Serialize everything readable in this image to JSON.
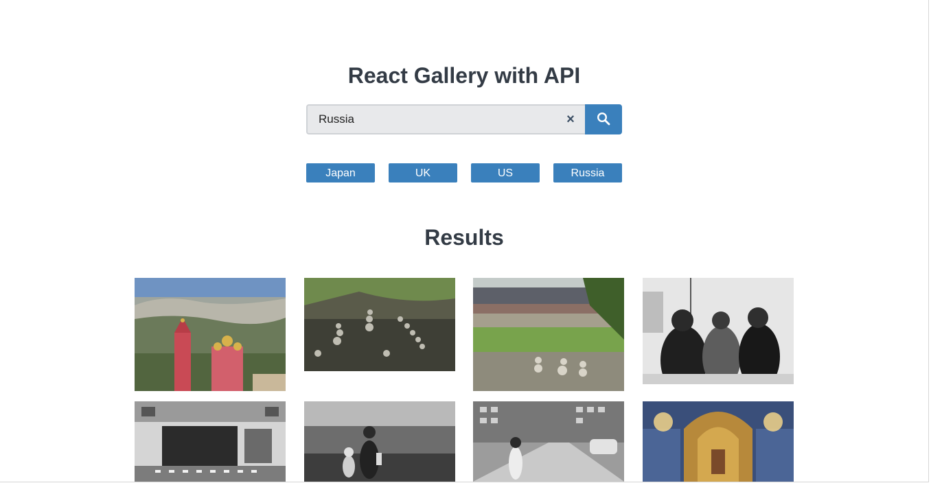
{
  "app": {
    "title": "React Gallery with API"
  },
  "search": {
    "value": "Russia",
    "clear_symbol": "×",
    "button_icon": "search-icon"
  },
  "tags": [
    {
      "label": "Japan"
    },
    {
      "label": "UK"
    },
    {
      "label": "US"
    },
    {
      "label": "Russia"
    }
  ],
  "results": {
    "heading": "Results",
    "photos": [
      {
        "subject": "church with red towers in front of hills"
      },
      {
        "subject": "stacked stone cairns on a hillside"
      },
      {
        "subject": "river under a bridge with stone stacks"
      },
      {
        "subject": "black and white people in winter jackets"
      },
      {
        "subject": "black and white building facade with crosswalk"
      },
      {
        "subject": "black and white mother and child walking"
      },
      {
        "subject": "black and white woman on a pedestrian bridge"
      },
      {
        "subject": "ornate cathedral interior with chandeliers"
      }
    ]
  },
  "colors": {
    "accent": "#3a80bc",
    "heading": "#333b45",
    "input_bg": "#e8e9eb"
  }
}
